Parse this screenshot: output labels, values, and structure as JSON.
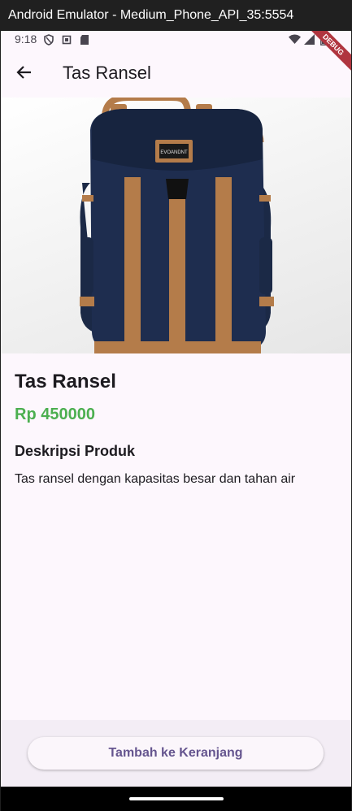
{
  "window": {
    "title": "Android Emulator - Medium_Phone_API_35:5554"
  },
  "status_bar": {
    "time": "9:18",
    "debug_banner": "DEBUG"
  },
  "app_bar": {
    "title": "Tas Ransel"
  },
  "product": {
    "name": "Tas Ransel",
    "price": "Rp 450000",
    "description_heading": "Deskripsi Produk",
    "description": "Tas ransel dengan kapasitas besar dan tahan air",
    "brand_patch": "EVOANDNT"
  },
  "actions": {
    "add_to_cart_label": "Tambah ke Keranjang"
  },
  "colors": {
    "background": "#fdf7fd",
    "price": "#4caf50",
    "button_text": "#65558f",
    "backpack_navy": "#1e2d4f",
    "backpack_tan": "#b87d4b"
  },
  "icons": [
    "back-arrow-icon",
    "shield-icon",
    "window-icon",
    "sd-card-icon",
    "wifi-icon",
    "signal-icon",
    "battery-icon"
  ]
}
